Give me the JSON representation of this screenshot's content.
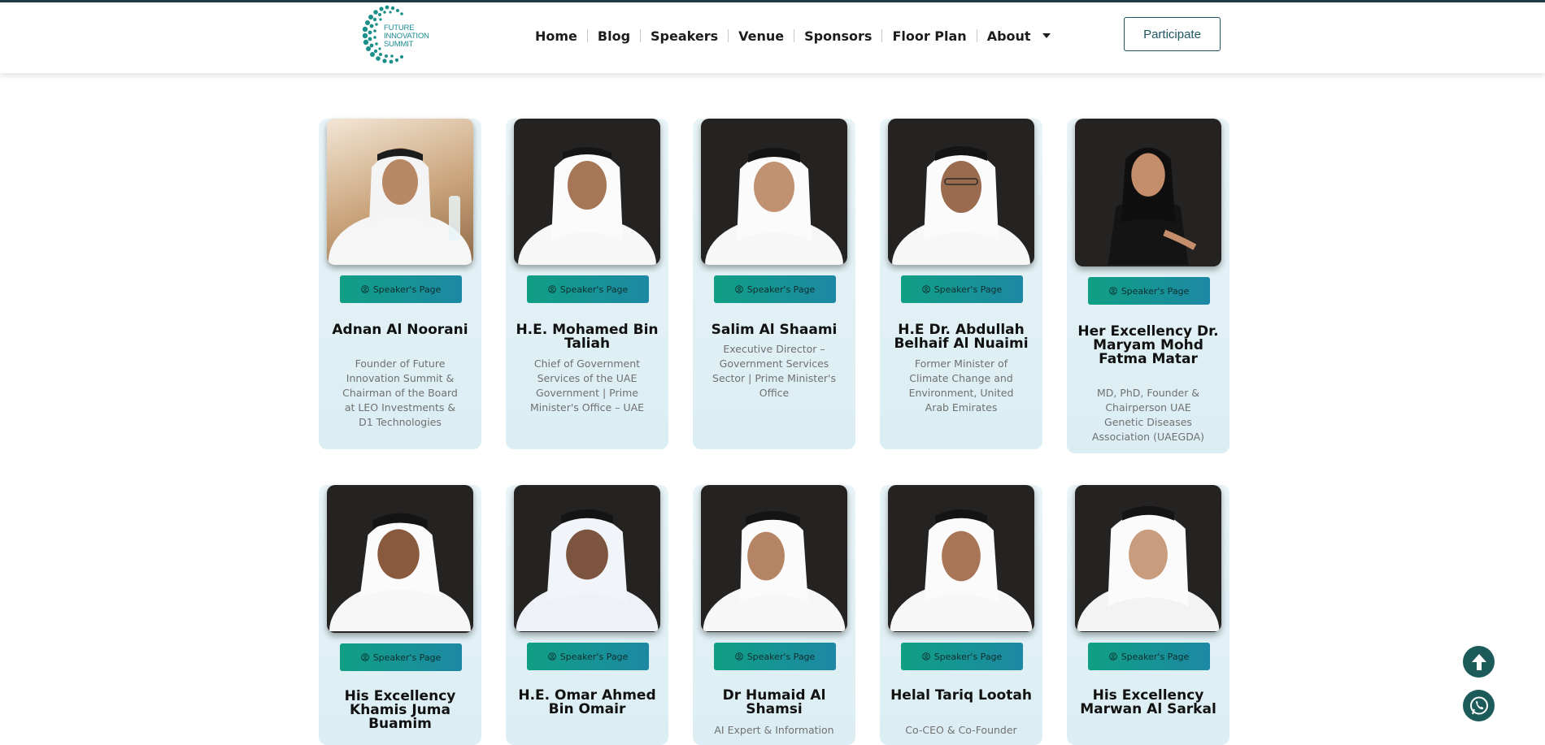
{
  "header": {
    "logo_text": [
      "FUTURE",
      "INNOVATION",
      "SUMMIT"
    ],
    "nav": [
      {
        "label": "Home"
      },
      {
        "label": "Blog"
      },
      {
        "label": "Speakers"
      },
      {
        "label": "Venue"
      },
      {
        "label": "Sponsors"
      },
      {
        "label": "Floor Plan"
      },
      {
        "label": "About",
        "has_dropdown": true
      }
    ],
    "cta_label": "Participate"
  },
  "speaker_button_label": "Speaker's Page",
  "speakers_row1": [
    {
      "name": "Adnan Al Noorani",
      "role": "Founder of Future Innovation Summit & Chairman of the Board at LEO Investments & D1 Technologies"
    },
    {
      "name": "H.E. Mohamed Bin Taliah",
      "role": "Chief of Government Services of the UAE Government | Prime Minister's Office – UAE"
    },
    {
      "name": "Salim Al Shaami",
      "role": "Executive Director – Government Services Sector | Prime Minister's Office"
    },
    {
      "name": "H.E Dr. Abdullah Belhaif Al Nuaimi",
      "role": "Former Minister of Climate Change and Environment, United Arab Emirates"
    },
    {
      "name": "Her Excellency Dr. Maryam Mohd Fatma Matar",
      "role": "MD, PhD, Founder & Chairperson UAE Genetic Diseases Association (UAEGDA)"
    }
  ],
  "speakers_row2": [
    {
      "name": "His Excellency Khamis Juma Buamim",
      "role": ""
    },
    {
      "name": "H.E. Omar Ahmed Bin Omair",
      "role": ""
    },
    {
      "name": "Dr Humaid Al Shamsi",
      "role": "AI Expert & Information"
    },
    {
      "name": "Helal Tariq Lootah",
      "role": "Co-CEO & Co-Founder"
    },
    {
      "name": "His Excellency Marwan Al Sarkal",
      "role": ""
    }
  ],
  "colors": {
    "accent_dark": "#1d5560",
    "button_gradient_start": "#109f84",
    "button_gradient_end": "#1d88a4",
    "card_bg": "#e3f1f5",
    "float_button": "#1c5b5a"
  }
}
